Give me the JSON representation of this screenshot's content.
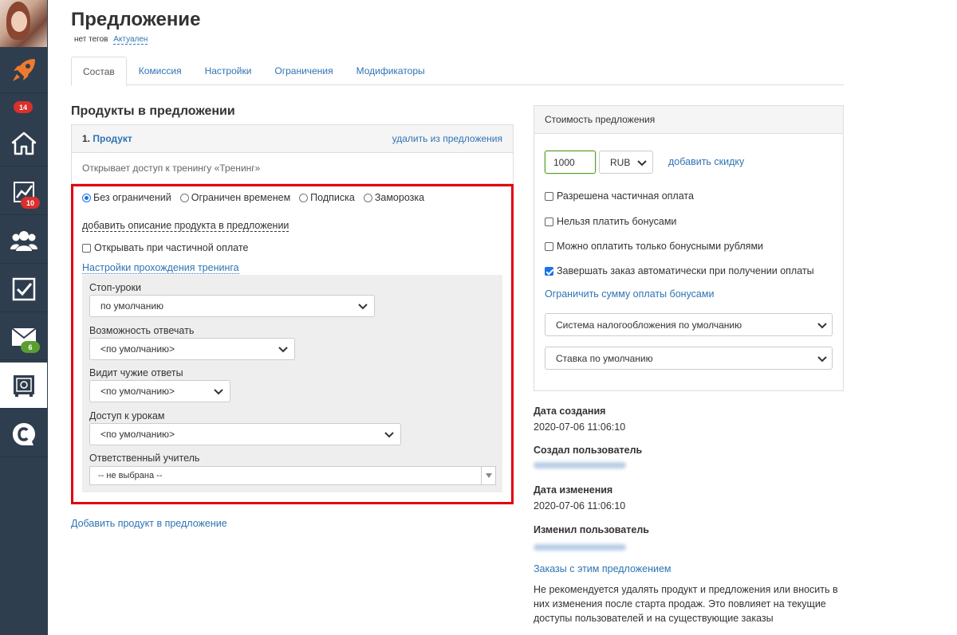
{
  "header": {
    "title": "Предложение",
    "tags": "нет тегов",
    "status": "Актуален"
  },
  "sidebar": {
    "items": [
      {
        "icon": "rocket-icon"
      },
      {
        "icon": "home-icon",
        "badge": "14",
        "badge_color": "#d9302c"
      },
      {
        "icon": "chart-icon",
        "badge": "10",
        "badge_color": "#d9302c"
      },
      {
        "icon": "users-icon"
      },
      {
        "icon": "checkbox-icon"
      },
      {
        "icon": "mail-icon",
        "badge": "6",
        "badge_color": "#5a9e31"
      },
      {
        "icon": "safe-icon",
        "active": true
      },
      {
        "icon": "chat-c-icon"
      }
    ]
  },
  "tabs": [
    {
      "label": "Состав",
      "active": true
    },
    {
      "label": "Комиссия"
    },
    {
      "label": "Настройки"
    },
    {
      "label": "Ограничения"
    },
    {
      "label": "Модификаторы"
    }
  ],
  "products": {
    "section_title": "Продукты в предложении",
    "item_number": "1.",
    "item_name": "Продукт",
    "remove_label": "удалить из предложения",
    "description": "Открывает доступ к тренингу «Тренинг»",
    "access_options": [
      {
        "label": "Без ограничений",
        "selected": true
      },
      {
        "label": "Ограничен временем",
        "selected": false
      },
      {
        "label": "Подписка",
        "selected": false
      },
      {
        "label": "Заморозка",
        "selected": false
      }
    ],
    "add_description_label": "добавить описание продукта в предложении",
    "open_on_partial_label": "Открывать при частичной оплате",
    "open_on_partial_checked": false,
    "training_settings_label": "Настройки прохождения тренинга",
    "settings": {
      "stop_lessons_label": "Стоп-уроки",
      "stop_lessons_value": "по умолчанию",
      "can_reply_label": "Возможность отвечать",
      "can_reply_value": "<по умолчанию>",
      "sees_others_label": "Видит чужие ответы",
      "sees_others_value": "<по умолчанию>",
      "lesson_access_label": "Доступ к урокам",
      "lesson_access_value": "<по умолчанию>",
      "teacher_label": "Ответственный учитель",
      "teacher_value": "-- не выбрана --"
    },
    "add_product_label": "Добавить продукт в предложение"
  },
  "price": {
    "panel_title": "Стоимость предложения",
    "amount": "1000",
    "currency": "RUB",
    "add_discount_label": "добавить скидку",
    "options": [
      {
        "label": "Разрешена частичная оплата",
        "checked": false
      },
      {
        "label": "Нельзя платить бонусами",
        "checked": false
      },
      {
        "label": "Можно оплатить только бонусными рублями",
        "checked": false
      },
      {
        "label": "Завершать заказ автоматически при получении оплаты",
        "checked": true
      }
    ],
    "limit_bonus_label": "Ограничить сумму оплаты бонусами",
    "tax_system": "Система налогообложения по умолчанию",
    "rate": "Ставка по умолчанию"
  },
  "meta": {
    "created_label": "Дата создания",
    "created_value": "2020-07-06 11:06:10",
    "created_by_label": "Создал пользователь",
    "modified_label": "Дата изменения",
    "modified_value": "2020-07-06 11:06:10",
    "modified_by_label": "Изменил пользователь",
    "orders_link": "Заказы с этим предложением",
    "warning": "Не рекомендуется удалять продукт и предложения или вносить в них изменения после старта продаж. Это повлияет на текущие доступы пользователей и на существующие заказы"
  },
  "colors": {
    "sidebar_bg": "#2f3e4e",
    "link": "#2f74b5",
    "highlight_border": "#e1000f"
  }
}
